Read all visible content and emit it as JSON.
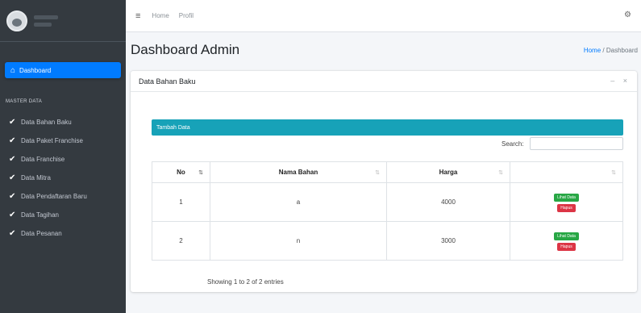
{
  "sidebar": {
    "active_item": {
      "icon": "home-icon",
      "label": "Dashboard"
    },
    "section_header": "MASTER DATA",
    "items": [
      {
        "icon": "check-icon",
        "label": "Data Bahan Baku"
      },
      {
        "icon": "check-icon",
        "label": "Data Paket Franchise"
      },
      {
        "icon": "check-icon",
        "label": "Data Franchise"
      },
      {
        "icon": "check-icon",
        "label": "Data Mitra"
      },
      {
        "icon": "check-icon",
        "label": "Data Pendaftaran Baru"
      },
      {
        "icon": "check-icon",
        "label": "Data Tagihan"
      },
      {
        "icon": "check-icon",
        "label": "Data Pesanan"
      }
    ]
  },
  "topbar": {
    "menu_icon": "≡",
    "links": [
      "Home",
      "Profil"
    ],
    "settings_icon": "⚙"
  },
  "header": {
    "title": "Dashboard Admin",
    "breadcrumb": {
      "home": "Home",
      "separator": "/",
      "current": "Dashboard"
    }
  },
  "card": {
    "title": "Data Bahan Baku",
    "tools": "– ×",
    "add_button": "Tambah Data",
    "search_label": "Search:",
    "search_value": "",
    "columns": [
      "No",
      "Nama Bahan",
      "Harga",
      ""
    ],
    "rows": [
      {
        "no": "1",
        "nama": "a",
        "harga": "4000",
        "edit": "Lihat Data",
        "delete": "Hapus"
      },
      {
        "no": "2",
        "nama": "n",
        "harga": "3000",
        "edit": "Lihat Data",
        "delete": "Hapus"
      }
    ],
    "info": "Showing 1 to 2 of 2 entries"
  },
  "colors": {
    "sidebar_bg": "#343a40",
    "active": "#007bff",
    "header_button": "#17a2b8",
    "edit": "#28a745",
    "delete": "#dc3545"
  }
}
